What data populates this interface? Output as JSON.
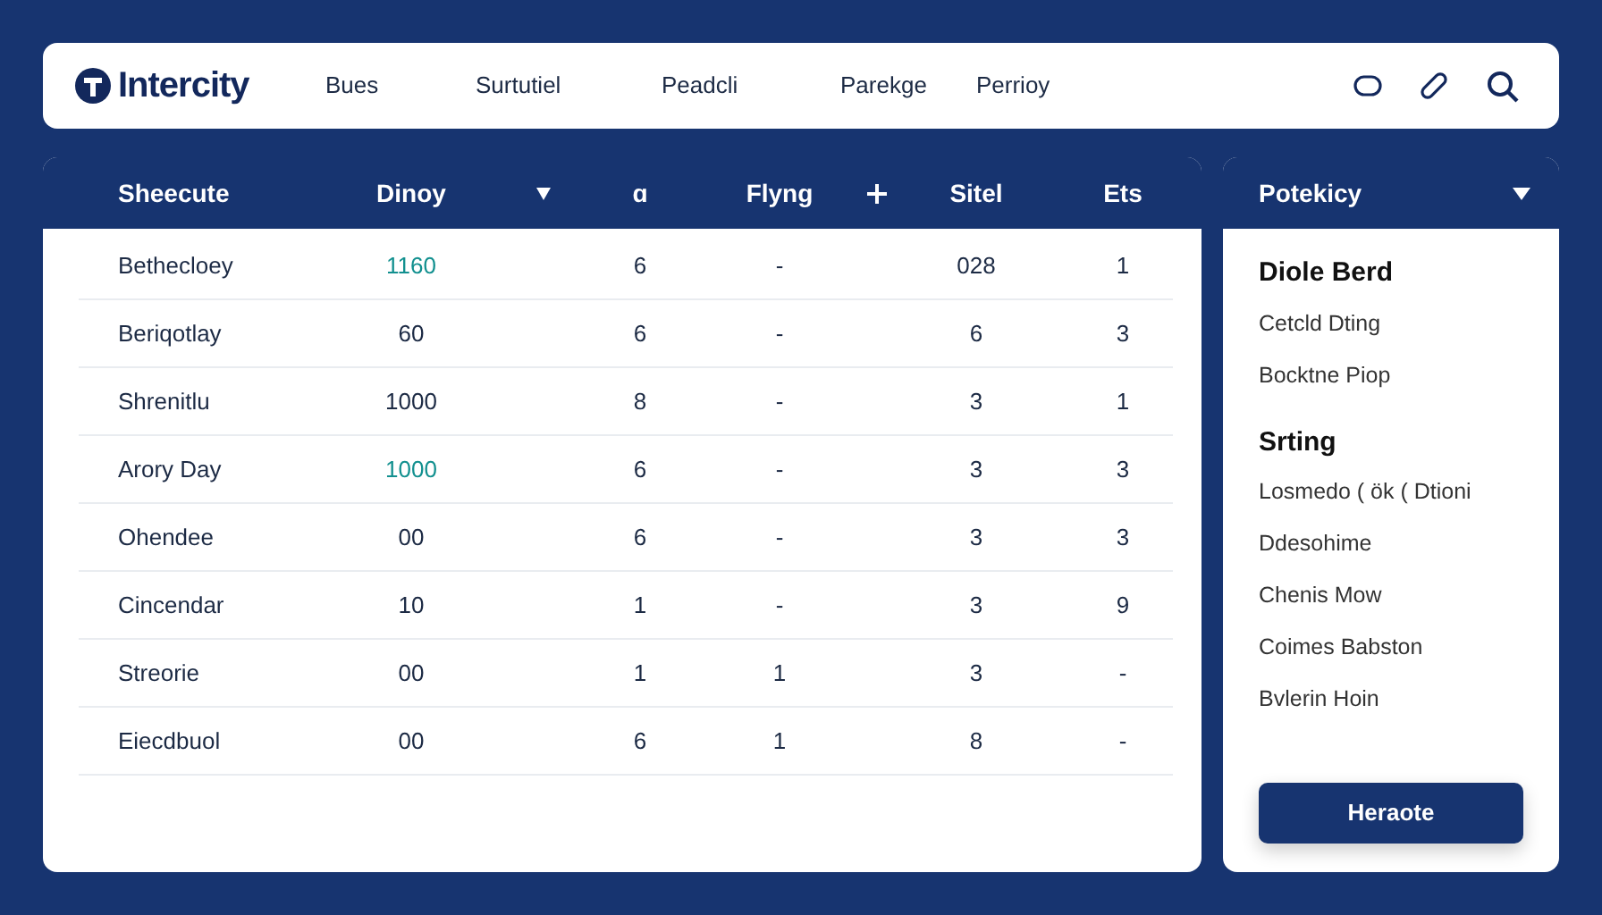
{
  "brand": "Intercity",
  "nav": [
    {
      "label": "Bues"
    },
    {
      "label": "Surtutiel"
    },
    {
      "label": "Peadcli"
    },
    {
      "label": "Parekge"
    },
    {
      "label": "Perrioy"
    }
  ],
  "table": {
    "columns": [
      {
        "kind": "text",
        "label": "Sheecute"
      },
      {
        "kind": "text",
        "label": "Dinoy"
      },
      {
        "kind": "sort"
      },
      {
        "kind": "text",
        "label": "ɑ"
      },
      {
        "kind": "text",
        "label": "Flyng"
      },
      {
        "kind": "add"
      },
      {
        "kind": "text",
        "label": "Sitel"
      },
      {
        "kind": "text",
        "label": "Ets"
      }
    ],
    "rows": [
      {
        "cells": [
          "Bethecloey",
          "1160",
          "",
          "6",
          "-",
          "",
          "028",
          "1"
        ],
        "accent": true
      },
      {
        "cells": [
          "Beriqotlay",
          "60",
          "",
          "6",
          "-",
          "",
          "6",
          "3"
        ],
        "accent": false
      },
      {
        "cells": [
          "Shrenitlu",
          "1000",
          "",
          "8",
          "-",
          "",
          "3",
          "1"
        ],
        "accent": false
      },
      {
        "cells": [
          "Arory Day",
          "1000",
          "",
          "6",
          "-",
          "",
          "3",
          "3"
        ],
        "accent": true
      },
      {
        "cells": [
          "Ohendee",
          "00",
          "",
          "6",
          "-",
          "",
          "3",
          "3"
        ],
        "accent": false
      },
      {
        "cells": [
          "Cincendar",
          "10",
          "",
          "1",
          "-",
          "",
          "3",
          "9"
        ],
        "accent": false
      },
      {
        "cells": [
          "Streorie",
          "00",
          "",
          "1",
          "1",
          "",
          "3",
          "-"
        ],
        "accent": false
      },
      {
        "cells": [
          "Eiecdbuol",
          "00",
          "",
          "6",
          "1",
          "",
          "8",
          "-"
        ],
        "accent": false
      }
    ]
  },
  "side": {
    "title": "Potekicy",
    "sections": [
      {
        "heading": "Diole Berd",
        "items": [
          "Cetcld Dting",
          "Bocktne Piop"
        ]
      },
      {
        "heading": "Srting",
        "items": [
          "Losmedo ( ök ( Dtioni",
          "Ddesohime",
          "Chenis Mow",
          "Coimes Babston",
          "Bvlerin Hoin"
        ]
      }
    ],
    "button": "Heraote"
  }
}
